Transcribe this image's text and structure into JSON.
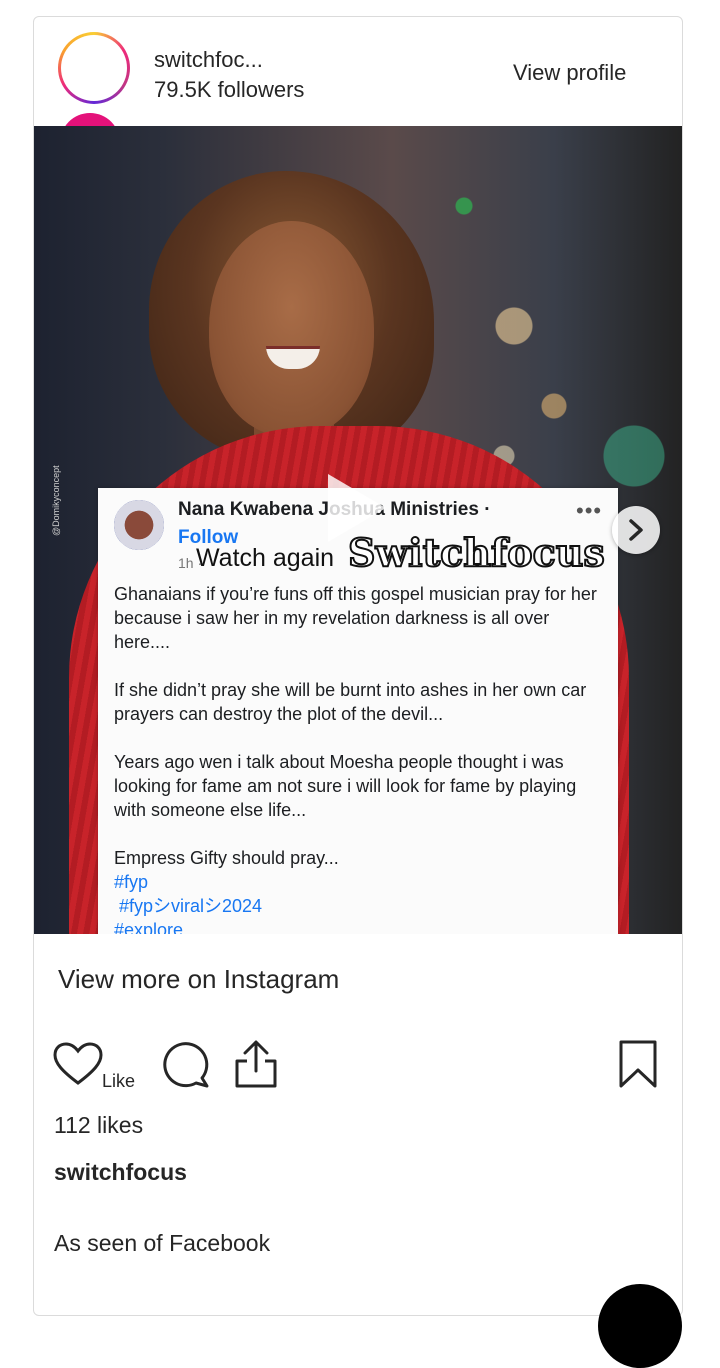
{
  "header": {
    "username": "switchfoc...",
    "followers": "79.5K followers",
    "view_profile": "View profile"
  },
  "media": {
    "watermark": "@Domikyconcept",
    "post": {
      "name": "Nana Kwabena Joshua Ministries ·",
      "follow": "Follow",
      "time": "1h ·",
      "menu": "•••",
      "paragraphs": [
        "Ghanaians if you’re funs off this gospel musician pray for her because i saw her in my revelation darkness is all over here....",
        "If she didn’t pray she will be burnt into ashes in her own car prayers can destroy the plot of the devil...",
        "Years ago wen i talk about Moesha people thought i was looking for fame am not sure i will look for fame by playing with someone else life...",
        "Empress Gifty should pray..."
      ],
      "tags": [
        "#fyp",
        "#fypシviralシ2024",
        "#explore"
      ]
    },
    "watch_again": "Watch again",
    "overlay_brand": "Switchfocus"
  },
  "view_more": "View more on Instagram",
  "actions": {
    "like_label": "Like"
  },
  "likes": "112 likes",
  "author": "switchfocus",
  "caption": "As seen of Facebook"
}
